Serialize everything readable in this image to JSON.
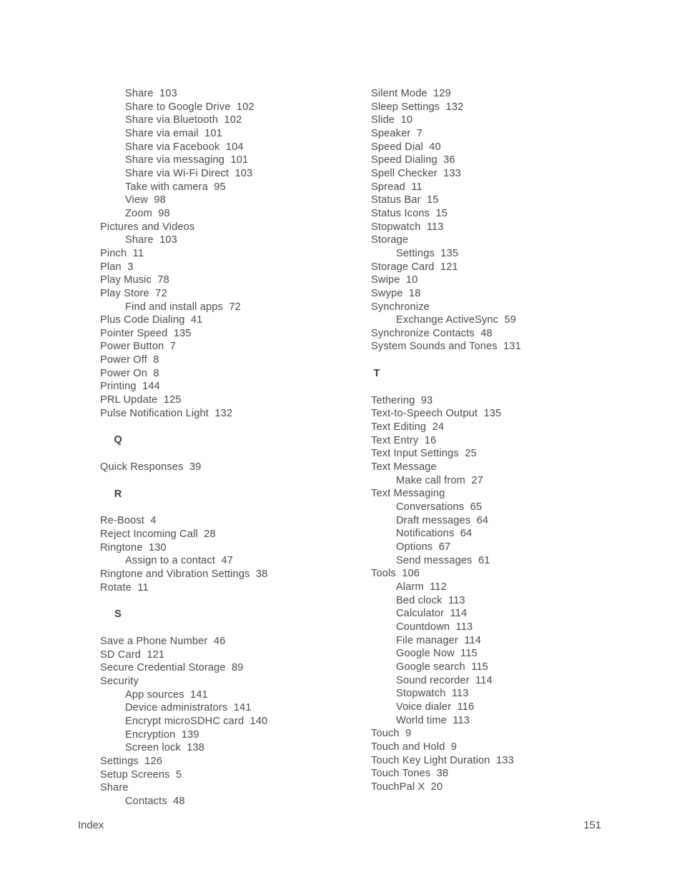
{
  "document": {
    "type": "index-page",
    "footer_label": "Index",
    "page_number": "151",
    "text_color": "#4a4a4a",
    "background_color": "#ffffff"
  },
  "columns": [
    {
      "name": "left-column",
      "blocks": [
        {
          "kind": "entry",
          "level": 2,
          "text": "Share  103"
        },
        {
          "kind": "entry",
          "level": 2,
          "text": "Share to Google Drive  102"
        },
        {
          "kind": "entry",
          "level": 2,
          "text": "Share via Bluetooth  102"
        },
        {
          "kind": "entry",
          "level": 2,
          "text": "Share via email  101"
        },
        {
          "kind": "entry",
          "level": 2,
          "text": "Share via Facebook  104"
        },
        {
          "kind": "entry",
          "level": 2,
          "text": "Share via messaging  101"
        },
        {
          "kind": "entry",
          "level": 2,
          "text": "Share via Wi-Fi Direct  103"
        },
        {
          "kind": "entry",
          "level": 2,
          "text": "Take with camera  95"
        },
        {
          "kind": "entry",
          "level": 2,
          "text": "View  98"
        },
        {
          "kind": "entry",
          "level": 2,
          "text": "Zoom  98"
        },
        {
          "kind": "entry",
          "level": 1,
          "text": "Pictures and Videos"
        },
        {
          "kind": "entry",
          "level": 2,
          "text": "Share  103"
        },
        {
          "kind": "entry",
          "level": 1,
          "text": "Pinch  11"
        },
        {
          "kind": "entry",
          "level": 1,
          "text": "Plan  3"
        },
        {
          "kind": "entry",
          "level": 1,
          "text": "Play Music  78"
        },
        {
          "kind": "entry",
          "level": 1,
          "text": "Play Store  72"
        },
        {
          "kind": "entry",
          "level": 2,
          "text": "Find and install apps  72"
        },
        {
          "kind": "entry",
          "level": 1,
          "text": "Plus Code Dialing  41"
        },
        {
          "kind": "entry",
          "level": 1,
          "text": "Pointer Speed  135"
        },
        {
          "kind": "entry",
          "level": 1,
          "text": "Power Button  7"
        },
        {
          "kind": "entry",
          "level": 1,
          "text": "Power Off  8"
        },
        {
          "kind": "entry",
          "level": 1,
          "text": "Power On  8"
        },
        {
          "kind": "entry",
          "level": 1,
          "text": "Printing  144"
        },
        {
          "kind": "entry",
          "level": 1,
          "text": "PRL Update  125"
        },
        {
          "kind": "entry",
          "level": 1,
          "text": "Pulse Notification Light  132"
        },
        {
          "kind": "letter",
          "text": "Q"
        },
        {
          "kind": "entry",
          "level": 1,
          "text": "Quick Responses  39"
        },
        {
          "kind": "letter",
          "text": "R"
        },
        {
          "kind": "entry",
          "level": 1,
          "text": "Re-Boost  4"
        },
        {
          "kind": "entry",
          "level": 1,
          "text": "Reject Incoming Call  28"
        },
        {
          "kind": "entry",
          "level": 1,
          "text": "Ringtone  130"
        },
        {
          "kind": "entry",
          "level": 2,
          "text": "Assign to a contact  47"
        },
        {
          "kind": "entry",
          "level": 1,
          "text": "Ringtone and Vibration Settings  38"
        },
        {
          "kind": "entry",
          "level": 1,
          "text": "Rotate  11"
        },
        {
          "kind": "letter",
          "text": "S"
        },
        {
          "kind": "entry",
          "level": 1,
          "text": "Save a Phone Number  46"
        },
        {
          "kind": "entry",
          "level": 1,
          "text": "SD Card  121"
        },
        {
          "kind": "entry",
          "level": 1,
          "text": "Secure Credential Storage  89"
        },
        {
          "kind": "entry",
          "level": 1,
          "text": "Security"
        },
        {
          "kind": "entry",
          "level": 2,
          "text": "App sources  141"
        },
        {
          "kind": "entry",
          "level": 2,
          "text": "Device administrators  141"
        },
        {
          "kind": "entry",
          "level": 2,
          "text": "Encrypt microSDHC card  140"
        },
        {
          "kind": "entry",
          "level": 2,
          "text": "Encryption  139"
        },
        {
          "kind": "entry",
          "level": 2,
          "text": "Screen lock  138"
        },
        {
          "kind": "entry",
          "level": 1,
          "text": "Settings  126"
        },
        {
          "kind": "entry",
          "level": 1,
          "text": "Setup Screens  5"
        },
        {
          "kind": "entry",
          "level": 1,
          "text": "Share"
        },
        {
          "kind": "entry",
          "level": 2,
          "text": "Contacts  48"
        }
      ]
    },
    {
      "name": "right-column",
      "blocks": [
        {
          "kind": "entry",
          "level": 1,
          "text": "Silent Mode  129"
        },
        {
          "kind": "entry",
          "level": 1,
          "text": "Sleep Settings  132"
        },
        {
          "kind": "entry",
          "level": 1,
          "text": "Slide  10"
        },
        {
          "kind": "entry",
          "level": 1,
          "text": "Speaker  7"
        },
        {
          "kind": "entry",
          "level": 1,
          "text": "Speed Dial  40"
        },
        {
          "kind": "entry",
          "level": 1,
          "text": "Speed Dialing  36"
        },
        {
          "kind": "entry",
          "level": 1,
          "text": "Spell Checker  133"
        },
        {
          "kind": "entry",
          "level": 1,
          "text": "Spread  11"
        },
        {
          "kind": "entry",
          "level": 1,
          "text": "Status Bar  15"
        },
        {
          "kind": "entry",
          "level": 1,
          "text": "Status Icons  15"
        },
        {
          "kind": "entry",
          "level": 1,
          "text": "Stopwatch  113"
        },
        {
          "kind": "entry",
          "level": 1,
          "text": "Storage"
        },
        {
          "kind": "entry",
          "level": 2,
          "text": "Settings  135"
        },
        {
          "kind": "entry",
          "level": 1,
          "text": "Storage Card  121"
        },
        {
          "kind": "entry",
          "level": 1,
          "text": "Swipe  10"
        },
        {
          "kind": "entry",
          "level": 1,
          "text": "Swype  18"
        },
        {
          "kind": "entry",
          "level": 1,
          "text": "Synchronize"
        },
        {
          "kind": "entry",
          "level": 2,
          "text": "Exchange ActiveSync  59"
        },
        {
          "kind": "entry",
          "level": 1,
          "text": "Synchronize Contacts  48"
        },
        {
          "kind": "entry",
          "level": 1,
          "text": "System Sounds and Tones  131"
        },
        {
          "kind": "letter",
          "text": "T"
        },
        {
          "kind": "entry",
          "level": 1,
          "text": "Tethering  93"
        },
        {
          "kind": "entry",
          "level": 1,
          "text": "Text-to-Speech Output  135"
        },
        {
          "kind": "entry",
          "level": 1,
          "text": "Text Editing  24"
        },
        {
          "kind": "entry",
          "level": 1,
          "text": "Text Entry  16"
        },
        {
          "kind": "entry",
          "level": 1,
          "text": "Text Input Settings  25"
        },
        {
          "kind": "entry",
          "level": 1,
          "text": "Text Message"
        },
        {
          "kind": "entry",
          "level": 2,
          "text": "Make call from  27"
        },
        {
          "kind": "entry",
          "level": 1,
          "text": "Text Messaging"
        },
        {
          "kind": "entry",
          "level": 2,
          "text": "Conversations  65"
        },
        {
          "kind": "entry",
          "level": 2,
          "text": "Draft messages  64"
        },
        {
          "kind": "entry",
          "level": 2,
          "text": "Notifications  64"
        },
        {
          "kind": "entry",
          "level": 2,
          "text": "Options  67"
        },
        {
          "kind": "entry",
          "level": 2,
          "text": "Send messages  61"
        },
        {
          "kind": "entry",
          "level": 1,
          "text": "Tools  106"
        },
        {
          "kind": "entry",
          "level": 2,
          "text": "Alarm  112"
        },
        {
          "kind": "entry",
          "level": 2,
          "text": "Bed clock  113"
        },
        {
          "kind": "entry",
          "level": 2,
          "text": "Calculator  114"
        },
        {
          "kind": "entry",
          "level": 2,
          "text": "Countdown  113"
        },
        {
          "kind": "entry",
          "level": 2,
          "text": "File manager  114"
        },
        {
          "kind": "entry",
          "level": 2,
          "text": "Google Now  115"
        },
        {
          "kind": "entry",
          "level": 2,
          "text": "Google search  115"
        },
        {
          "kind": "entry",
          "level": 2,
          "text": "Sound recorder  114"
        },
        {
          "kind": "entry",
          "level": 2,
          "text": "Stopwatch  113"
        },
        {
          "kind": "entry",
          "level": 2,
          "text": "Voice dialer  116"
        },
        {
          "kind": "entry",
          "level": 2,
          "text": "World time  113"
        },
        {
          "kind": "entry",
          "level": 1,
          "text": "Touch  9"
        },
        {
          "kind": "entry",
          "level": 1,
          "text": "Touch and Hold  9"
        },
        {
          "kind": "entry",
          "level": 1,
          "text": "Touch Key Light Duration  133"
        },
        {
          "kind": "entry",
          "level": 1,
          "text": "Touch Tones  38"
        },
        {
          "kind": "entry",
          "level": 1,
          "text": "TouchPal X  20"
        }
      ]
    }
  ]
}
